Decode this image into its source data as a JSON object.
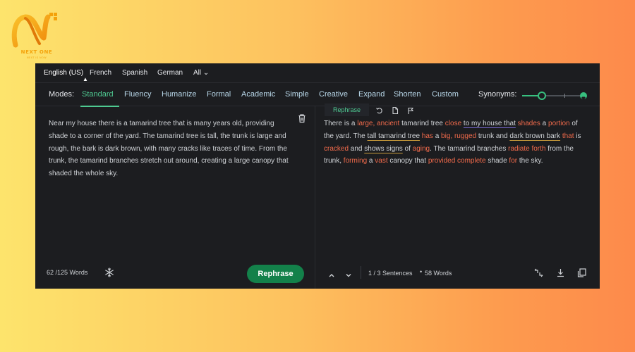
{
  "brand": {
    "name": "NEXT ONE",
    "tagline": "NEXT IS NOW",
    "orange": "#f4a20a"
  },
  "languages": [
    {
      "label": "English (US)",
      "active": true
    },
    {
      "label": "French"
    },
    {
      "label": "Spanish"
    },
    {
      "label": "German"
    },
    {
      "label": "All ⌄"
    }
  ],
  "modes": {
    "label": "Modes:",
    "items": [
      "Standard",
      "Fluency",
      "Humanize",
      "Formal",
      "Academic",
      "Simple",
      "Creative",
      "Expand",
      "Shorten",
      "Custom"
    ],
    "active": "Standard"
  },
  "synonyms": {
    "label": "Synonyms:",
    "level": 0.33
  },
  "input": {
    "text": "Near my house there is a tamarind tree that is many years old, providing shade to a corner of the yard. The tamarind tree is tall, the trunk is large and rough, the bark is dark brown, with many cracks like traces of time. From the trunk, the tamarind branches stretch out around, creating a large canopy that shaded the whole sky.",
    "word_count": "62 /125 Words",
    "rephrase_button": "Rephrase"
  },
  "output": {
    "tab_label": "Rephrase",
    "segments": [
      {
        "t": "There is a "
      },
      {
        "t": "large, ancient",
        "c": 1
      },
      {
        "t": " tamarind tree "
      },
      {
        "t": "close",
        "c": 1
      },
      {
        "t": " "
      },
      {
        "t": "to my house that",
        "u": 1
      },
      {
        "t": " "
      },
      {
        "t": "shades",
        "c": 1
      },
      {
        "t": " a "
      },
      {
        "t": "portion",
        "c": 1
      },
      {
        "t": " of the yard. The "
      },
      {
        "t": "tall tamarind tree",
        "uo": 1
      },
      {
        "t": " "
      },
      {
        "t": "has",
        "c": 1
      },
      {
        "t": " a "
      },
      {
        "t": "big, rugged",
        "c": 1
      },
      {
        "t": " trunk and "
      },
      {
        "t": "dark brown bark",
        "uo": 1
      },
      {
        "t": " "
      },
      {
        "t": "that",
        "c": 1
      },
      {
        "t": " is "
      },
      {
        "t": "cracked",
        "c": 1
      },
      {
        "t": " and "
      },
      {
        "t": "shows signs",
        "uo": 1
      },
      {
        "t": " of "
      },
      {
        "t": "aging",
        "c": 1
      },
      {
        "t": ". The tamarind branches "
      },
      {
        "t": "radiate forth",
        "c": 1
      },
      {
        "t": " from the trunk, "
      },
      {
        "t": "forming",
        "c": 1
      },
      {
        "t": " a "
      },
      {
        "t": "vast",
        "c": 1
      },
      {
        "t": " canopy that "
      },
      {
        "t": "provided complete",
        "c": 1
      },
      {
        "t": " shade "
      },
      {
        "t": "for",
        "c": 1
      },
      {
        "t": " the sky."
      }
    ],
    "sentences": "1 / 3 Sentences",
    "dot": "•",
    "word_count": "58 Words"
  },
  "icons": {
    "trash": "trash-icon",
    "undo": "undo-icon",
    "document": "document-icon",
    "flag": "flag-icon",
    "freeze": "snowflake-icon",
    "up": "chevron-up-icon",
    "down": "chevron-down-icon",
    "compare": "compare-icon",
    "download": "download-icon",
    "copy": "copy-icon"
  },
  "colors": {
    "accent": "#4ec991",
    "changed": "#f06a4b",
    "button": "#13814a",
    "panel": "#1c1d20"
  }
}
